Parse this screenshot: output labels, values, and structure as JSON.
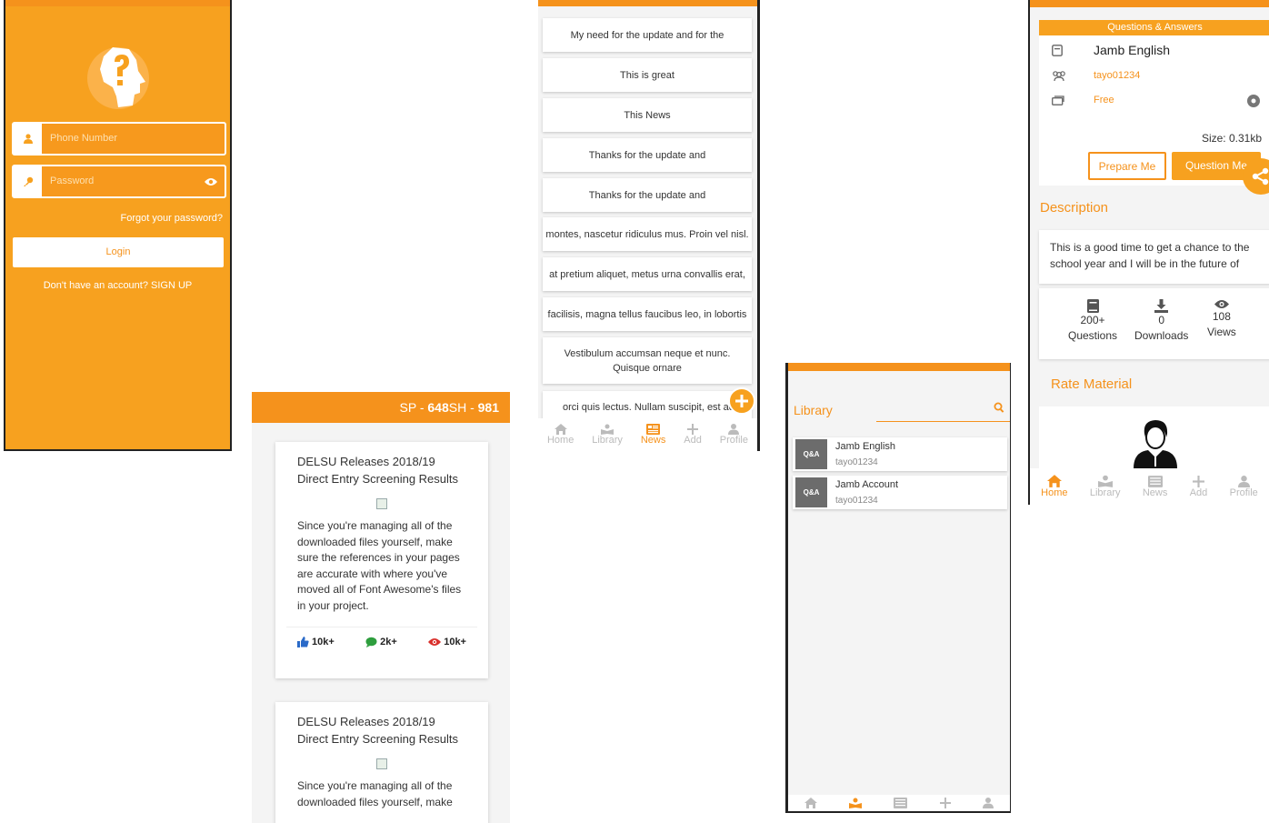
{
  "login": {
    "phone_placeholder": "Phone Number",
    "password_placeholder": "Password",
    "forgot": "Forgot your password?",
    "login_button": "Login",
    "signup": "Don't have an account? SIGN UP"
  },
  "feed": {
    "header_prefix": "SP - ",
    "header_bold1": "648",
    "header_mid": "SH - ",
    "header_bold2": "981",
    "cards": [
      {
        "title": "DELSU Releases 2018/19 Direct Entry Screening Results",
        "body": "Since you're managing all of the downloaded files yourself, make sure the references in your pages are accurate with where you've moved all of Font Awesome's files in your project.",
        "likes": "10k+",
        "comments": "2k+",
        "views": "10k+"
      },
      {
        "title": "DELSU Releases 2018/19 Direct Entry Screening Results",
        "body": "Since you're managing all of the downloaded files yourself, make"
      }
    ]
  },
  "comments": {
    "items": [
      "My need for the update and for the",
      "This is great",
      "This News",
      "Thanks for the update and",
      "Thanks for the update and",
      "montes, nascetur ridiculus mus. Proin vel nisl.",
      "at pretium aliquet, metus urna convallis erat,",
      "facilisis, magna tellus faucibus leo, in lobortis",
      "Vestibulum accumsan neque et nunc. Quisque ornare",
      "orci quis lectus. Nullam suscipit, est ac"
    ],
    "nav": [
      "Home",
      "Library",
      "News",
      "Add",
      "Profile"
    ],
    "active": "News"
  },
  "library": {
    "title": "Library",
    "items": [
      {
        "name": "Jamb English",
        "user": "tayo01234",
        "thumb": "Q&A"
      },
      {
        "name": "Jamb Account",
        "user": "tayo01234",
        "thumb": "Q&A"
      }
    ]
  },
  "detail": {
    "section_header": "Questions & Answers",
    "name": "Jamb English",
    "user": "tayo01234",
    "price": "Free",
    "size": "Size: 0.31kb",
    "prepare_button": "Prepare Me",
    "question_button": "Question Me",
    "description_title": "Description",
    "description": "This is a good time to get a chance to the school year and I will be in the future of",
    "stats": [
      {
        "value": "200+",
        "label": "Questions",
        "icon": "book-icon"
      },
      {
        "value": "0",
        "label": "Downloads",
        "icon": "download-icon"
      },
      {
        "value": "108",
        "label": "Views",
        "icon": "eye-icon"
      }
    ],
    "rate_title": "Rate Material",
    "nav": [
      "Home",
      "Library",
      "News",
      "Add",
      "Profile"
    ],
    "active": "Home"
  },
  "colors": {
    "accent": "#f5921c",
    "accent_light": "#f7a11f"
  }
}
